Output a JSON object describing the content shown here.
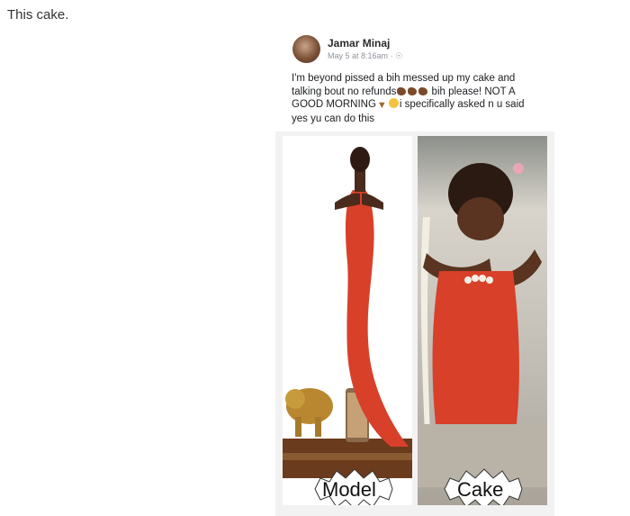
{
  "caption": "This cake.",
  "post": {
    "author": "Jamar Minaj",
    "meta": "May 5 at 8:16am",
    "separator": "·",
    "privacy_icon": "globe-icon",
    "line1": "I'm beyond pissed a bih messed up my  cake and",
    "line2a": "talking bout no refunds",
    "line2b": " bih please! NOT A",
    "line3a": "GOOD MORNING",
    "line3b": "i specifically asked n u said",
    "line4": "yes yu can do this"
  },
  "images": {
    "left_label": "Model",
    "right_label": "Cake"
  },
  "colors": {
    "dress_red": "#d8402a",
    "skin": "#4a2a1c",
    "meta_gray": "#90949c"
  }
}
